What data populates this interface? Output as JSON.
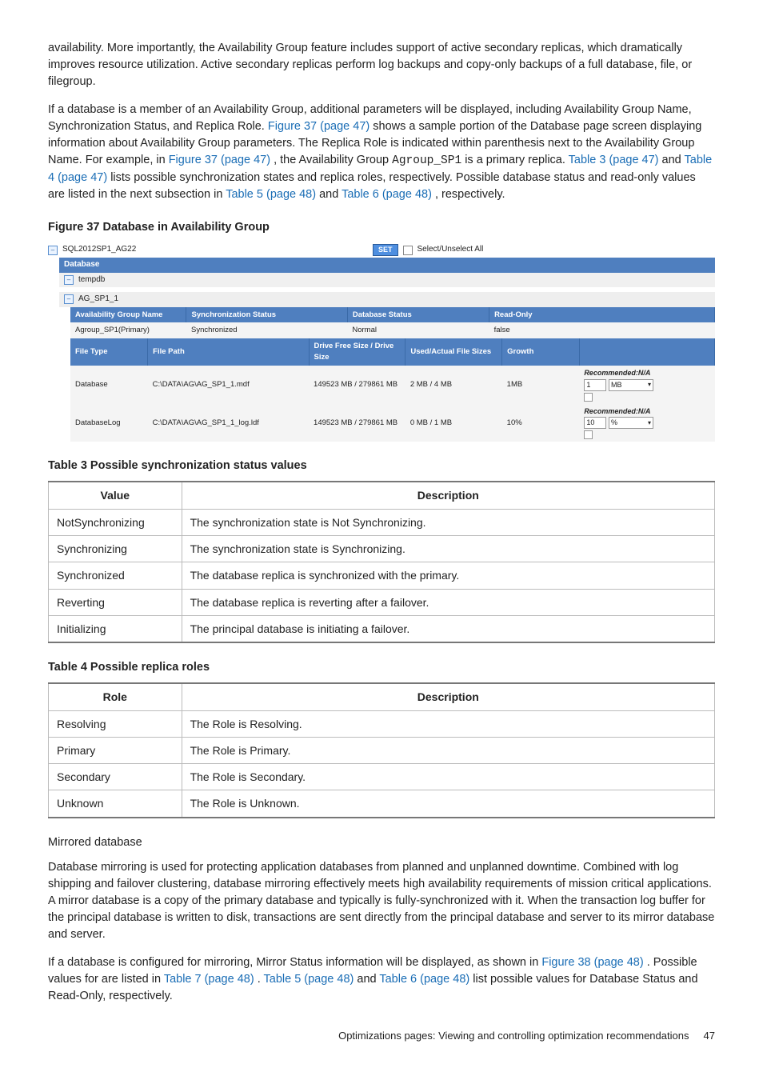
{
  "para1": "availability. More importantly, the Availability Group feature includes support of active secondary replicas, which dramatically improves resource utilization. Active secondary replicas perform log backups and copy-only backups of a full database, file, or filegroup.",
  "para2a": "If a database is a member of an Availability Group, additional parameters will be displayed, including Availability Group Name, Synchronization Status, and Replica Role. ",
  "link_fig37a": "Figure 37 (page 47)",
  "para2b": " shows a sample portion of the Database page screen displaying information about Availability Group parameters. The Replica Role is indicated within parenthesis next to the Availability Group Name. For example, in ",
  "link_fig37b": "Figure 37 (page 47)",
  "para2c": ", the Availability Group ",
  "code_ag": "Agroup_SP1",
  "para2d": " is a primary replica. ",
  "link_tbl3": "Table 3 (page 47)",
  "para2e": " and ",
  "link_tbl4": "Table 4 (page 47)",
  "para2f": " lists possible synchronization states and replica roles, respectively. Possible database status and read-only values are listed in the next subsection in ",
  "link_tbl5": "Table 5 (page 48)",
  "para2g": " and ",
  "link_tbl6": "Table 6 (page 48)",
  "para2h": ", respectively.",
  "fig37_caption": "Figure 37 Database in Availability Group",
  "screenshot": {
    "sql_node": "SQL2012SP1_AG22",
    "set_button": "SET",
    "select_all": "Select/Unselect All",
    "database_header": "Database",
    "tempdb": "tempdb",
    "ag_node": "AG_SP1_1",
    "hdr_ag_name": "Availability Group Name",
    "hdr_sync": "Synchronization Status",
    "hdr_dbstatus": "Database Status",
    "hdr_readonly": "Read-Only",
    "row1_ag": "Agroup_SP1(Primary)",
    "row1_sync": "Synchronized",
    "row1_status": "Normal",
    "row1_ro": "false",
    "hdr_filetype": "File Type",
    "hdr_filepath": "File Path",
    "hdr_drivefree": "Drive Free Size / Drive Size",
    "hdr_used": "Used/Actual File Sizes",
    "hdr_growth": "Growth",
    "r_db": "Database",
    "r_db_path": "C:\\DATA\\AG\\AG_SP1_1.mdf",
    "r_db_drive": "149523 MB / 279861 MB",
    "r_db_used": "2 MB / 4 MB",
    "r_db_growth": "1MB",
    "r_log": "DatabaseLog",
    "r_log_path": "C:\\DATA\\AG\\AG_SP1_1_log.ldf",
    "r_log_drive": "149523 MB / 279861 MB",
    "r_log_used": "0 MB / 1 MB",
    "r_log_growth": "10%",
    "rec_label": "Recommended:N/A",
    "val1": "1",
    "unit_mb": "MB",
    "val2": "10",
    "unit_pct": "%"
  },
  "tbl3_caption": "Table 3 Possible synchronization status values",
  "tbl3_h1": "Value",
  "tbl3_h2": "Description",
  "tbl3_rows": {
    "r0v": "NotSynchronizing",
    "r0d": "The synchronization state is Not Synchronizing.",
    "r1v": "Synchronizing",
    "r1d": "The synchronization state is Synchronizing.",
    "r2v": "Synchronized",
    "r2d": "The database replica is synchronized with the primary.",
    "r3v": "Reverting",
    "r3d": "The database replica is reverting after a failover.",
    "r4v": "Initializing",
    "r4d": "The principal database is initiating a failover."
  },
  "tbl4_caption": "Table 4 Possible replica roles",
  "tbl4_h1": "Role",
  "tbl4_h2": "Description",
  "tbl4_rows": {
    "r0v": "Resolving",
    "r0d": "The Role is Resolving.",
    "r1v": "Primary",
    "r1d": "The Role is Primary.",
    "r2v": "Secondary",
    "r2d": "The Role is Secondary.",
    "r3v": "Unknown",
    "r3d": "The Role is Unknown."
  },
  "mirror_heading": "Mirrored database",
  "mirror_p1": "Database mirroring is used for protecting application databases from planned and unplanned downtime. Combined with log shipping and failover clustering, database mirroring effectively meets high availability requirements of mission critical applications. A mirror database is a copy of the primary database and typically is fully-synchronized with it. When the transaction log buffer for the principal database is written to disk, transactions are sent directly from the principal database and server to its mirror database and server.",
  "mirror_p2a": "If a database is configured for mirroring, Mirror Status information will be displayed, as shown in ",
  "link_fig38": "Figure 38 (page 48)",
  "mirror_p2b": ". Possible values for are listed in ",
  "link_tbl7": "Table 7 (page 48)",
  "mirror_p2c": ". ",
  "link_tbl5b": "Table 5 (page 48)",
  "mirror_p2d": " and ",
  "link_tbl6b": "Table 6 (page 48)",
  "mirror_p2e": " list possible values for Database Status and Read-Only, respectively.",
  "footer_text": "Optimizations pages: Viewing and controlling optimization recommendations",
  "page_num": "47"
}
